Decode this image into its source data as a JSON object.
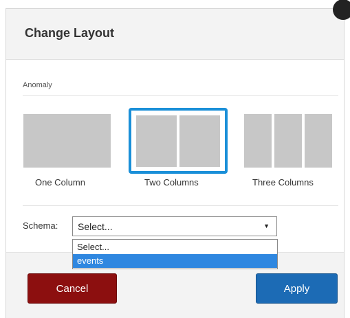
{
  "dialog": {
    "title": "Change Layout",
    "section_label": "Anomaly"
  },
  "layouts": [
    {
      "label": "One Column",
      "columns": 1,
      "selected": false
    },
    {
      "label": "Two Columns",
      "columns": 2,
      "selected": true
    },
    {
      "label": "Three Columns",
      "columns": 3,
      "selected": false
    }
  ],
  "schema": {
    "label": "Schema:",
    "selected_value": "Select...",
    "options": [
      "Select...",
      "events"
    ],
    "highlighted_option": "events"
  },
  "buttons": {
    "cancel_label": "Cancel",
    "apply_label": "Apply"
  },
  "colors": {
    "selected_border": "#1a8fd8",
    "cancel_bg": "#8c0f0f",
    "apply_bg": "#1c6bb5",
    "option_highlight": "#2f87e0"
  }
}
